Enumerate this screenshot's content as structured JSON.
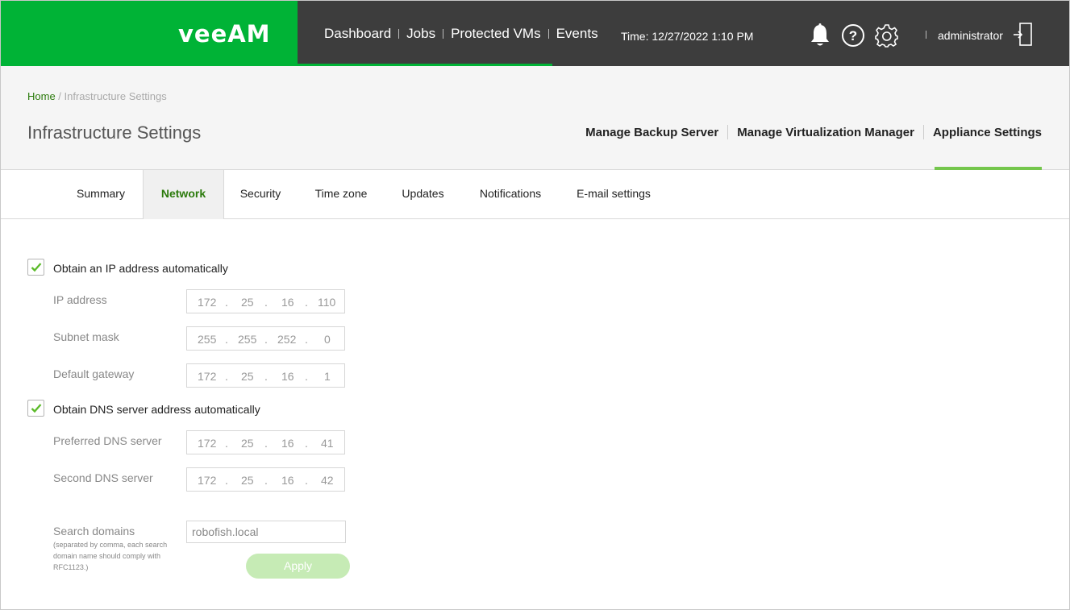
{
  "app": {
    "logo": "veeAM",
    "nav": [
      "Dashboard",
      "Jobs",
      "Protected VMs",
      "Events"
    ],
    "time": "Time: 12/27/2022 1:10 PM",
    "user": "administrator"
  },
  "breadcrumb": {
    "home": "Home",
    "current": " / Infrastructure Settings"
  },
  "page_title": "Infrastructure Settings",
  "management": [
    "Manage Backup Server",
    "Manage Virtualization Manager",
    "Appliance Settings"
  ],
  "tabs": [
    "Summary",
    "Network",
    "Security",
    "Time zone",
    "Updates",
    "Notifications",
    "E-mail settings"
  ],
  "active_tab": "Network",
  "network": {
    "obtain_ip_label": "Obtain an IP address automatically",
    "obtain_ip_checked": true,
    "ip_address": {
      "label": "IP address",
      "octets": [
        "172",
        "25",
        "16",
        "110"
      ]
    },
    "subnet_mask": {
      "label": "Subnet mask",
      "octets": [
        "255",
        "255",
        "252",
        "0"
      ]
    },
    "default_gateway": {
      "label": "Default gateway",
      "octets": [
        "172",
        "25",
        "16",
        "1"
      ]
    },
    "obtain_dns_label": "Obtain DNS server address automatically",
    "obtain_dns_checked": true,
    "preferred_dns": {
      "label": "Preferred DNS server",
      "octets": [
        "172",
        "25",
        "16",
        "41"
      ]
    },
    "second_dns": {
      "label": "Second DNS server",
      "octets": [
        "172",
        "25",
        "16",
        "42"
      ]
    },
    "search_domains": {
      "label": "Search domains",
      "value": "robofish.local",
      "hint": "(separated by comma, each search domain name should comply with RFC1123.)"
    },
    "dot": ".",
    "apply_label": "Apply"
  },
  "colors": {
    "brand_green": "#00b336",
    "topbar": "#3d3d3d",
    "active_text": "#2b7a0b",
    "accent_underline": "#74c64c",
    "apply_disabled": "#c6ebb5"
  }
}
